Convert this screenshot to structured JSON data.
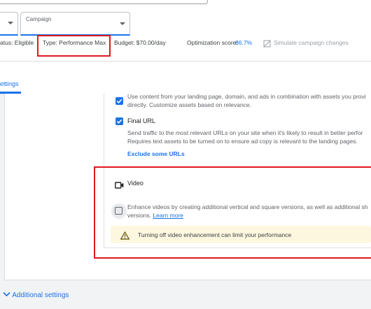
{
  "header": {
    "campaign_dropdown": {
      "label": "Campaign"
    },
    "status": "atus: Eligible",
    "type": "Type: Performance Max",
    "budget": "Budget: $70.00/day",
    "optimization_label": "Optimization score:",
    "optimization_value": "86.7%",
    "simulate": "Simulate campaign changes"
  },
  "tabs": {
    "active_label": "ettings"
  },
  "assets": {
    "text_customization": {
      "line1": "Use content from your landing page, domain, and ads in combination with assets you provi",
      "line2": "directly. Customize assets based on relevance."
    },
    "final_url": {
      "title": "Final URL",
      "line1": "Send traffic to the most relevant URLs on your site when it's likely to result in better perfor",
      "line2": "Requires text assets to be turned on to ensure ad copy is relevant to the landing pages.",
      "link": "Exclude some URLs"
    },
    "video": {
      "title": "Video",
      "line1": "Enhance videos by creating additional vertical and square versions, as well as additional sh",
      "line2_prefix": "versions.",
      "learn_more": "Learn more",
      "warning": "Turning off video enhancement can limit your performance"
    }
  },
  "footer": {
    "additional_settings": "Additional settings"
  },
  "colors": {
    "accent": "#1a73e8",
    "highlight": "#e0191f",
    "warning_bg": "#fef7e0"
  },
  "icons": [
    "chevron-down-icon",
    "simulate-icon",
    "checkbox-checked-icon",
    "video-camera-icon",
    "warning-icon",
    "expand-chevron-icon"
  ]
}
